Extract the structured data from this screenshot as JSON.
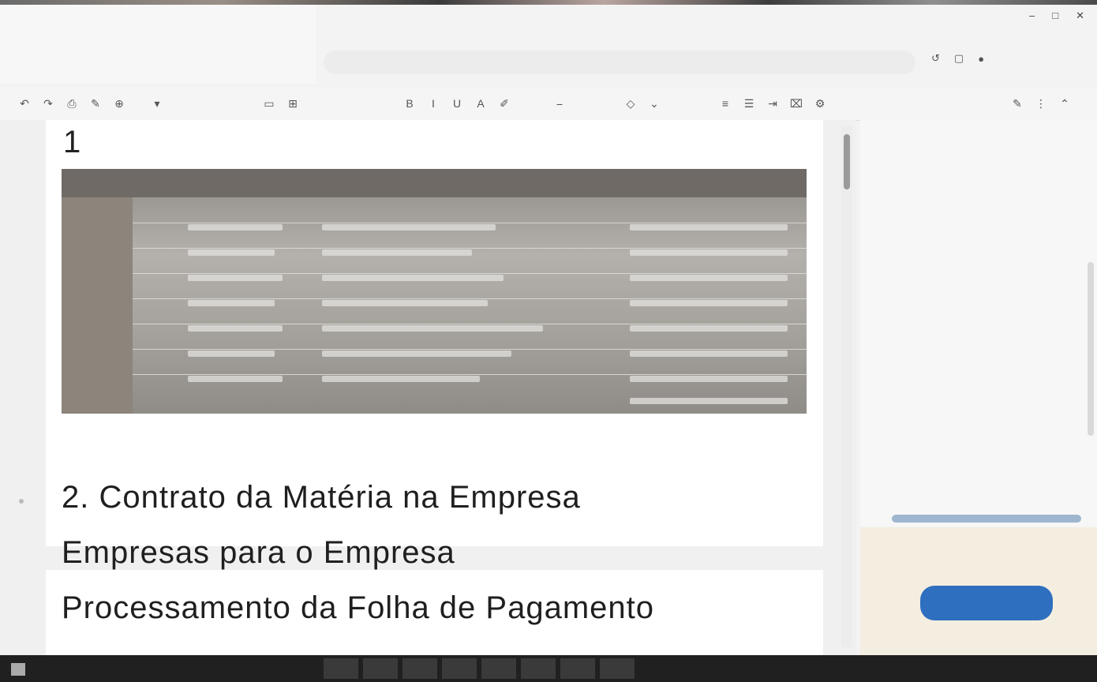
{
  "window": {
    "title": "",
    "meta": "",
    "controls": [
      "–",
      "□",
      "✕"
    ]
  },
  "menu": [
    "",
    "",
    ""
  ],
  "search": {
    "placeholder": ""
  },
  "toolbar_icons": [
    "undo-icon",
    "redo-icon",
    "print-icon",
    "paint-format-icon",
    "zoom-icon",
    "select-icon",
    "comment-icon",
    "bold-icon",
    "italic-icon",
    "underline-icon",
    "font-color-icon",
    "link-icon",
    "image-icon",
    "align-left-icon",
    "list-icon",
    "indent-icon",
    "clear-format-icon",
    "settings-icon",
    "more-icon",
    "pen-icon",
    "collapse-icon"
  ],
  "document": {
    "page_number": "1",
    "headings": [
      "2. Contrato da Matéria na Empresa",
      "Empresas para o Empresa",
      "Processamento da Folha de Pagamento"
    ]
  },
  "sidebar": {
    "header": "",
    "items": [
      "",
      "",
      "",
      "",
      "",
      ""
    ],
    "promo_text": "",
    "promo_button": ""
  },
  "taskbar": {
    "left_lines": [
      "",
      ""
    ],
    "tray_text": ""
  }
}
